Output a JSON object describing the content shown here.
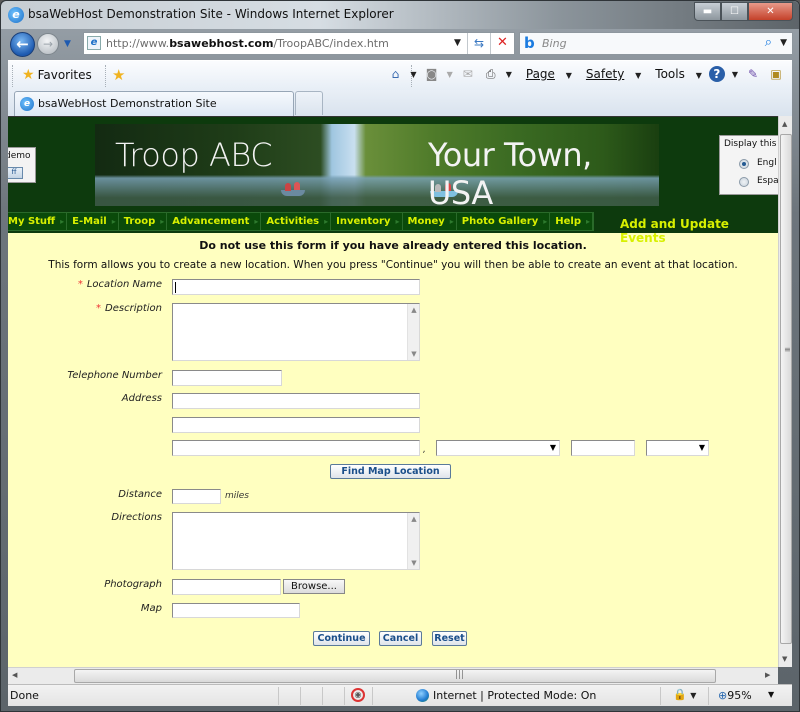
{
  "window": {
    "title": "bsaWebHost Demonstration Site - Windows Internet Explorer",
    "controls": {
      "minimize": "▬",
      "maximize": "☐",
      "close": "✕"
    }
  },
  "navbar": {
    "url_domain_prefix": "http://www.",
    "url_domain": "bsawebhost.com",
    "url_path": "/TroopABC/index.htm",
    "search_placeholder": "Bing",
    "icons": {
      "back": "back-arrow-icon",
      "forward": "forward-arrow-icon",
      "refresh": "refresh-icon",
      "stop": "stop-icon",
      "search": "search-icon"
    }
  },
  "commandbar": {
    "favorites_label": "Favorites",
    "page_label": "Page",
    "safety_label": "Safety",
    "tools_label": "Tools"
  },
  "tabs": [
    {
      "label": "bsaWebHost Demonstration Site",
      "active": true
    }
  ],
  "site": {
    "login_box": {
      "label": "demo",
      "button": "ff"
    },
    "banner_left": "Troop ABC",
    "banner_right": "Your Town, USA",
    "language_box": {
      "title": "Display this",
      "options": [
        {
          "label": "Engl",
          "checked": true
        },
        {
          "label": "Espa",
          "checked": false
        }
      ]
    },
    "menu": [
      "My Stuff",
      "E-Mail",
      "Troop",
      "Advancement",
      "Activities",
      "Inventory",
      "Money",
      "Photo Gallery",
      "Help"
    ],
    "page_heading": "Add and Update Events"
  },
  "form": {
    "warning": "Do not use this form if you have already entered this location.",
    "info": "This form allows you to create a new location. When you press \"Continue\" you will then be able to create an event at that location.",
    "required_marker": "*",
    "labels": {
      "location_name": "Location Name",
      "description": "Description",
      "telephone": "Telephone Number",
      "address": "Address",
      "distance": "Distance",
      "directions": "Directions",
      "photograph": "Photograph",
      "map": "Map"
    },
    "values": {
      "location_name": "",
      "description": "",
      "telephone": "",
      "address1": "",
      "address2": "",
      "city": "",
      "state": "",
      "zip": "",
      "country": "",
      "distance": "",
      "directions": "",
      "photograph": "",
      "map": ""
    },
    "city_separator": ",",
    "distance_unit": "miles",
    "find_map_button": "Find Map Location",
    "browse_button": "Browse...",
    "continue_button": "Continue",
    "cancel_button": "Cancel",
    "reset_button": "Reset"
  },
  "statusbar": {
    "status": "Done",
    "zone": "Internet | Protected Mode: On",
    "zoom": "95%"
  }
}
